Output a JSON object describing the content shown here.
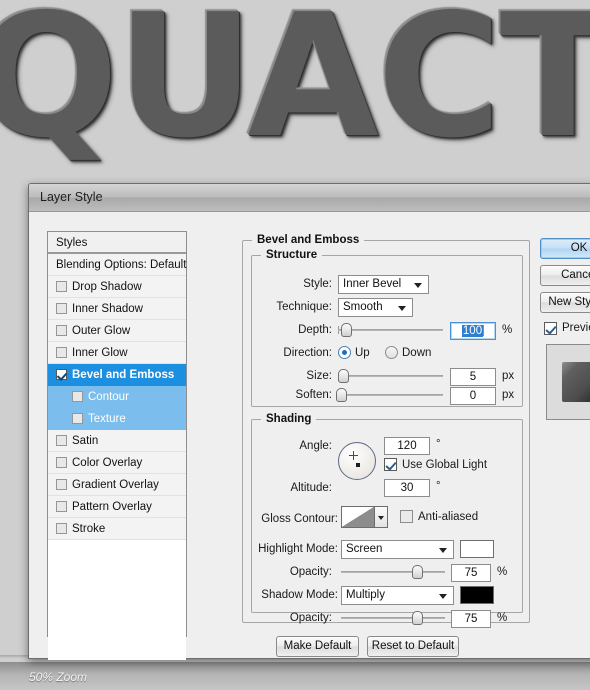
{
  "canvas": {
    "artwork_text": "QUACT",
    "status_text": "50% Zoom",
    "background_color": "#cfcfcf",
    "text_color": "#5b5b5b"
  },
  "dialog": {
    "title": "Layer Style",
    "close_icon": "close-icon"
  },
  "styles_panel": {
    "header": "Styles",
    "blending_options": "Blending Options: Default",
    "items": [
      {
        "label": "Drop Shadow",
        "checked": false,
        "selected": false,
        "sub": false
      },
      {
        "label": "Inner Shadow",
        "checked": false,
        "selected": false,
        "sub": false
      },
      {
        "label": "Outer Glow",
        "checked": false,
        "selected": false,
        "sub": false
      },
      {
        "label": "Inner Glow",
        "checked": false,
        "selected": false,
        "sub": false
      },
      {
        "label": "Bevel and Emboss",
        "checked": true,
        "selected": true,
        "sub": false
      },
      {
        "label": "Contour",
        "checked": false,
        "selected": false,
        "sub": true
      },
      {
        "label": "Texture",
        "checked": false,
        "selected": false,
        "sub": true
      },
      {
        "label": "Satin",
        "checked": false,
        "selected": false,
        "sub": false
      },
      {
        "label": "Color Overlay",
        "checked": false,
        "selected": false,
        "sub": false
      },
      {
        "label": "Gradient Overlay",
        "checked": false,
        "selected": false,
        "sub": false
      },
      {
        "label": "Pattern Overlay",
        "checked": false,
        "selected": false,
        "sub": false
      },
      {
        "label": "Stroke",
        "checked": false,
        "selected": false,
        "sub": false
      }
    ],
    "selected_color": "#1d8fe0",
    "sub_selected_color": "#7bbdec"
  },
  "bevel": {
    "group_title": "Bevel and Emboss",
    "structure": {
      "group_title": "Structure",
      "style_label": "Style:",
      "style_value": "Inner Bevel",
      "technique_label": "Technique:",
      "technique_value": "Smooth",
      "depth_label": "Depth:",
      "depth_value": "100",
      "depth_unit": "%",
      "direction_label": "Direction:",
      "direction_up": "Up",
      "direction_down": "Down",
      "direction_selected": "Up",
      "size_label": "Size:",
      "size_value": "5",
      "size_unit": "px",
      "soften_label": "Soften:",
      "soften_value": "0",
      "soften_unit": "px"
    },
    "shading": {
      "group_title": "Shading",
      "angle_label": "Angle:",
      "angle_value": "120",
      "angle_unit": "°",
      "global_light_label": "Use Global Light",
      "global_light_checked": true,
      "altitude_label": "Altitude:",
      "altitude_value": "30",
      "altitude_unit": "°",
      "gloss_contour_label": "Gloss Contour:",
      "anti_aliased_label": "Anti-aliased",
      "anti_aliased_checked": false,
      "highlight_mode_label": "Highlight Mode:",
      "highlight_mode_value": "Screen",
      "highlight_color": "#ffffff",
      "highlight_opacity_label": "Opacity:",
      "highlight_opacity_value": "75",
      "highlight_opacity_unit": "%",
      "shadow_mode_label": "Shadow Mode:",
      "shadow_mode_value": "Multiply",
      "shadow_color": "#000000",
      "shadow_opacity_label": "Opacity:",
      "shadow_opacity_value": "75",
      "shadow_opacity_unit": "%"
    }
  },
  "buttons": {
    "ok": "OK",
    "cancel": "Cancel",
    "new_style": "New Style...",
    "preview": "Preview",
    "preview_checked": true,
    "make_default": "Make Default",
    "reset_to_default": "Reset to Default"
  }
}
